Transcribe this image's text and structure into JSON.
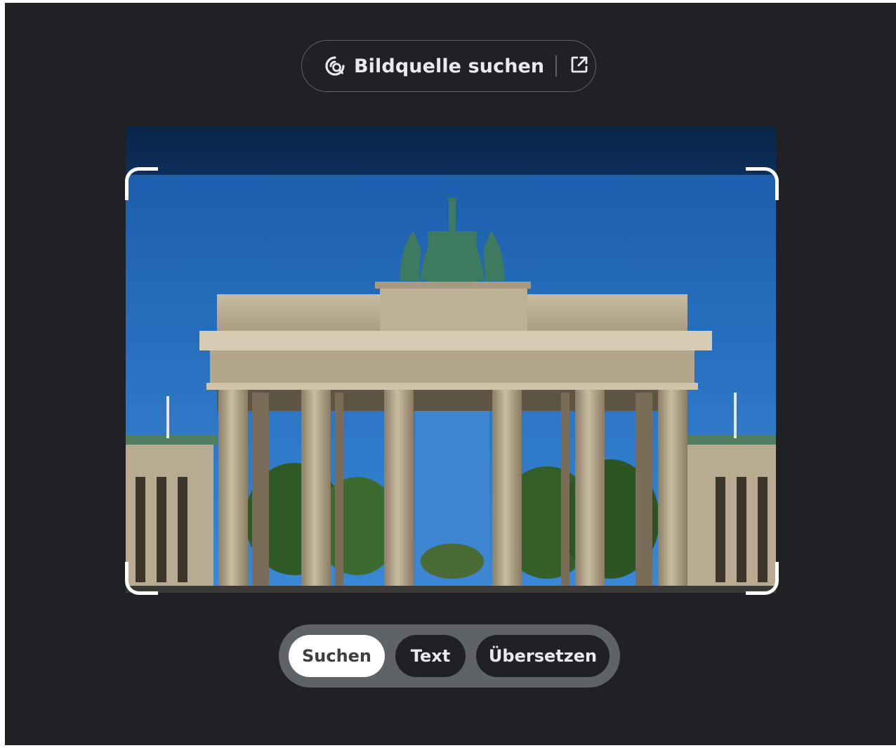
{
  "header": {
    "source_label": "Bildquelle suchen",
    "source_icon": "lens-search-icon",
    "open_icon": "open-in-new-icon"
  },
  "modes": [
    {
      "label": "Suchen",
      "active": true
    },
    {
      "label": "Text",
      "active": false
    },
    {
      "label": "Übersetzen",
      "active": false
    }
  ],
  "colors": {
    "background": "#202124",
    "chip_active": "#ffffff",
    "chip_inactive": "#202124",
    "bar": "#5f6368",
    "sky": "#1e66b3"
  }
}
